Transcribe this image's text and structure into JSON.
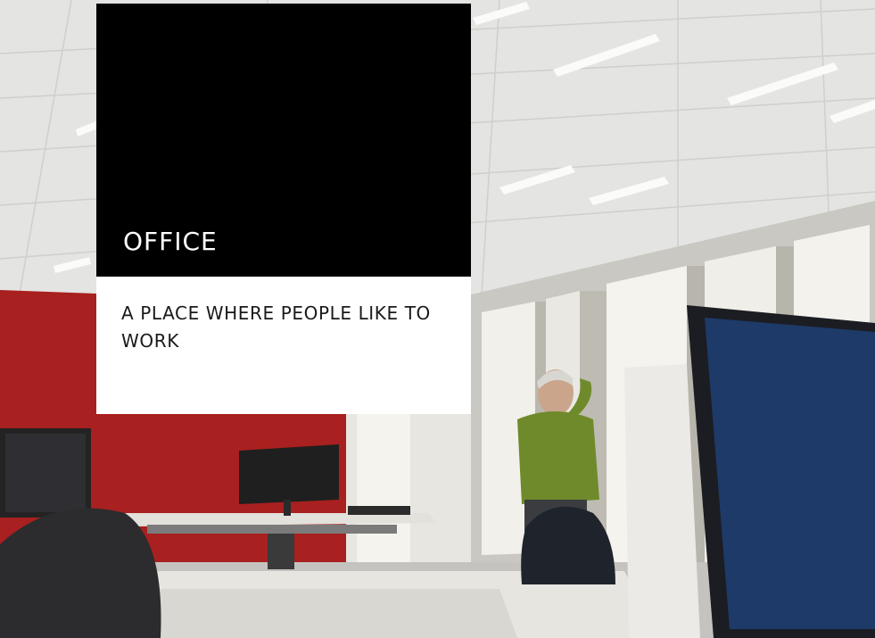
{
  "hero": {
    "title": "OFFICE",
    "subtitle": "A PLACE WHERE PEOPLE LIKE TO WORK"
  },
  "colors": {
    "title_panel": "#000000",
    "subtitle_panel": "#ffffff",
    "title_text": "#ffffff",
    "subtitle_text": "#1a1a1a",
    "wall_red": "#a8201f"
  }
}
